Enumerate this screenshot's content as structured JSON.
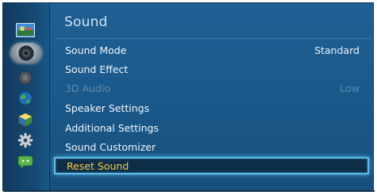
{
  "panel": {
    "title": "Sound"
  },
  "sidebar": {
    "icons": [
      {
        "name": "picture-icon"
      },
      {
        "name": "sound-icon",
        "selected": true
      },
      {
        "name": "broadcast-icon"
      },
      {
        "name": "network-icon"
      },
      {
        "name": "system-icon"
      },
      {
        "name": "support-icon"
      },
      {
        "name": "smart-hub-icon"
      }
    ]
  },
  "menu": {
    "items": [
      {
        "label": "Sound Mode",
        "value": "Standard",
        "disabled": false
      },
      {
        "label": "Sound Effect",
        "value": "",
        "disabled": false
      },
      {
        "label": "3D Audio",
        "value": "Low",
        "disabled": true
      },
      {
        "label": "Speaker Settings",
        "value": "",
        "disabled": false
      },
      {
        "label": "Additional Settings",
        "value": "",
        "disabled": false
      },
      {
        "label": "Sound Customizer",
        "value": "",
        "disabled": false
      },
      {
        "label": "Reset Sound",
        "value": "",
        "disabled": false,
        "selected": true
      }
    ]
  },
  "colors": {
    "highlight_text": "#f5c841",
    "highlight_border": "#5fbde8",
    "panel_bg": "#1f5f93",
    "disabled_text": "#5e8aae"
  }
}
